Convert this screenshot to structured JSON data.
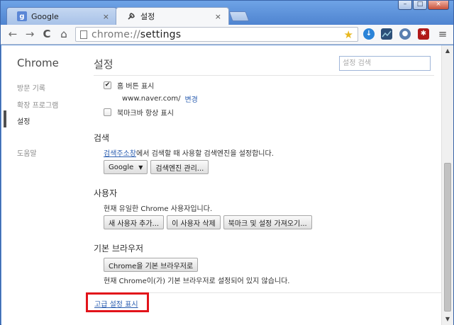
{
  "tabs": [
    {
      "label": "Google",
      "favicon": "g",
      "close": "×"
    },
    {
      "label": "설정",
      "close": "×"
    }
  ],
  "window_controls": {
    "minimize": "–",
    "maximize": "□",
    "close": "×"
  },
  "toolbar": {
    "back": "←",
    "forward": "→",
    "reload": "C",
    "home": "⌂",
    "url_scheme": "chrome://",
    "url_path": "settings",
    "star": "★",
    "menu": "≡"
  },
  "sidebar": {
    "title": "Chrome",
    "items": [
      {
        "label": "방문 기록"
      },
      {
        "label": "확장 프로그램"
      },
      {
        "label": "설정"
      },
      {
        "label": "도움말"
      }
    ]
  },
  "main": {
    "title": "설정",
    "search_placeholder": "설정 검색",
    "home_button": {
      "label": "홈 버튼 표시",
      "checked": true,
      "url": "www.naver.com/",
      "change_link": "변경"
    },
    "bookmarks_bar": {
      "label": "북마크바 항상 표시",
      "checked": false
    },
    "search_section": {
      "title": "검색",
      "desc_link": "검색주소창",
      "desc_rest": "에서 검색할 때 사용할 검색엔진을 설정합니다.",
      "engine": "Google",
      "manage_button": "검색엔진 관리..."
    },
    "users_section": {
      "title": "사용자",
      "desc": "현재 유일한 Chrome 사용자입니다.",
      "buttons": [
        "새 사용자 추가...",
        "이 사용자 삭제",
        "북마크 및 설정 가져오기..."
      ]
    },
    "default_browser_section": {
      "title": "기본 브라우저",
      "button": "Chrome을 기본 브라우저로",
      "desc": "현재 Chrome이(가) 기본 브라우저로 설정되어 있지 않습니다."
    },
    "advanced_link": "고급 설정 표시"
  },
  "colors": {
    "highlight_box": "#e2131a",
    "link": "#2a5db0",
    "frame": "#5c8fd6"
  }
}
